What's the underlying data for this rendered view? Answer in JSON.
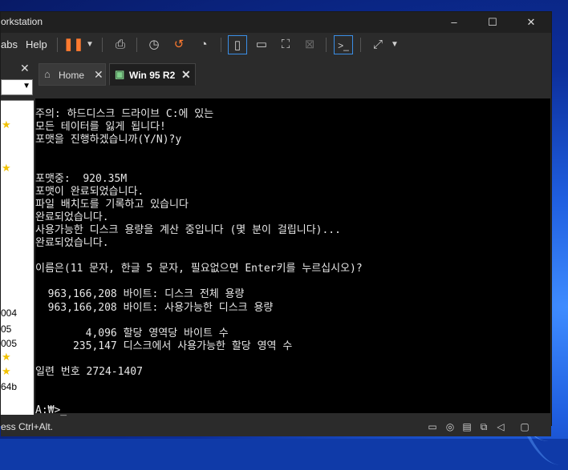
{
  "window": {
    "title": "orkstation"
  },
  "window_controls": {
    "minimize": "–",
    "maximize": "☐",
    "close": "✕"
  },
  "menu": {
    "tabs_label": "abs",
    "help_label": "Help"
  },
  "sidebar": {
    "close": "✕",
    "items": [
      "004",
      "05",
      "005",
      "",
      "",
      "64b"
    ]
  },
  "tabs": [
    {
      "label": "Home",
      "close": "✕"
    },
    {
      "label": "Win 95 R2",
      "close": "✕"
    }
  ],
  "console_lines": [
    "주의: 하드디스크 드라이브 C:에 있는",
    "모든 테이터를 잃게 됩니다!",
    "포맷을 진행하겠습니까(Y/N)?y",
    "",
    "",
    "포맷중:  920.35M",
    "포맷이 완료되었습니다.",
    "파일 배치도를 기록하고 있습니다",
    "완료되었습니다.",
    "사용가능한 디스크 용량을 계산 중입니다 (몇 분이 걸립니다)...",
    "완료되었습니다.",
    "",
    "이름은(11 문자, 한글 5 문자, 필요없으면 Enter키를 누르십시오)?",
    "",
    "  963,166,208 바이트: 디스크 전체 용량",
    "  963,166,208 바이트: 사용가능한 디스크 용량",
    "",
    "        4,096 할당 영역당 바이트 수",
    "      235,147 디스크에서 사용가능한 할당 영역 수",
    "",
    "일련 번호 2724-1407",
    "",
    "",
    "A:₩>_"
  ],
  "status": {
    "hint": "ess Ctrl+Alt."
  }
}
